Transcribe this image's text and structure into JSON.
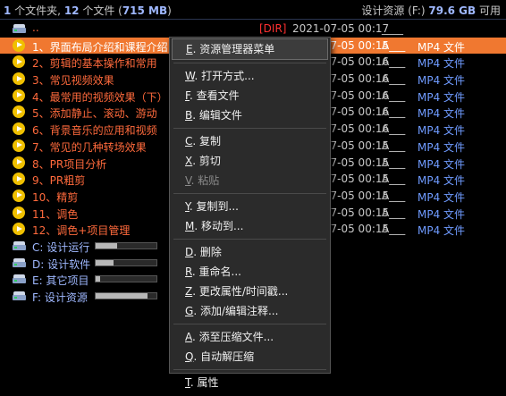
{
  "header": {
    "folders_count": "1",
    "folders_text": " 个文件夹, ",
    "files_count": "12",
    "files_text": " 个文件 (",
    "size": "715 MB",
    "size_close": ")",
    "drive_label": "设计资源 (F:) ",
    "free_space": "79.6 GB",
    "free_text": " 可用"
  },
  "parent_row": {
    "name": "..",
    "tag": "[DIR]",
    "date": "2021-07-05  00:17",
    "attr": "____"
  },
  "files": [
    {
      "name": "1、界面布局介绍和课程介绍",
      "date": "2021-07-05  00:15",
      "attr": "A___",
      "type": "MP4 文件"
    },
    {
      "name": "2、剪辑的基本操作和常用",
      "date": "2021-07-05  00:16",
      "attr": "A___",
      "type": "MP4 文件"
    },
    {
      "name": "3、常见视频效果",
      "date": "2021-07-05  00:16",
      "attr": "A___",
      "type": "MP4 文件"
    },
    {
      "name": "4、最常用的视频效果（下）",
      "date": "2021-07-05  00:16",
      "attr": "A___",
      "type": "MP4 文件"
    },
    {
      "name": "5、添加静止、滚动、游动",
      "date": "2021-07-05  00:16",
      "attr": "A___",
      "type": "MP4 文件"
    },
    {
      "name": "6、背景音乐的应用和视频",
      "date": "2021-07-05  00:16",
      "attr": "A___",
      "type": "MP4 文件"
    },
    {
      "name": "7、常见的几种转场效果",
      "date": "2021-07-05  00:15",
      "attr": "A___",
      "type": "MP4 文件"
    },
    {
      "name": "8、PR项目分析",
      "date": "2021-07-05  00:15",
      "attr": "A___",
      "type": "MP4 文件"
    },
    {
      "name": "9、PR粗剪",
      "date": "2021-07-05  00:15",
      "attr": "A___",
      "type": "MP4 文件"
    },
    {
      "name": "10、精剪",
      "date": "2021-07-05  00:15",
      "attr": "A___",
      "type": "MP4 文件"
    },
    {
      "name": "11、调色",
      "date": "2021-07-05  00:15",
      "attr": "A___",
      "type": "MP4 文件"
    },
    {
      "name": "12、调色+项目管理",
      "date": "2021-07-05  00:15",
      "attr": "A___",
      "type": "MP4 文件"
    }
  ],
  "drives": [
    {
      "name": "C: 设计运行",
      "used_fraction": 0.35
    },
    {
      "name": "D: 设计软件",
      "used_fraction": 0.3
    },
    {
      "name": "E: 其它项目",
      "used_fraction": 0.08
    },
    {
      "name": "F: 设计资源",
      "used_fraction": 0.85
    }
  ],
  "context_menu": {
    "items": [
      {
        "key": "E",
        "label": ". 资源管理器菜单",
        "disabled": false
      },
      {
        "sep": true
      },
      {
        "key": "W",
        "label": ". 打开方式...",
        "disabled": false
      },
      {
        "key": "F",
        "label": ". 查看文件",
        "disabled": false
      },
      {
        "key": "B",
        "label": ". 编辑文件",
        "disabled": false
      },
      {
        "sep": true
      },
      {
        "key": "C",
        "label": ". 复制",
        "disabled": false
      },
      {
        "key": "X",
        "label": ". 剪切",
        "disabled": false
      },
      {
        "key": "V",
        "label": ". 粘贴",
        "disabled": true
      },
      {
        "sep": true
      },
      {
        "key": "Y",
        "label": ". 复制到...",
        "disabled": false
      },
      {
        "key": "M",
        "label": ". 移动到...",
        "disabled": false
      },
      {
        "sep": true
      },
      {
        "key": "D",
        "label": ". 删除",
        "disabled": false
      },
      {
        "key": "R",
        "label": ". 重命名...",
        "disabled": false
      },
      {
        "key": "Z",
        "label": ". 更改属性/时间戳...",
        "disabled": false
      },
      {
        "key": "G",
        "label": ". 添加/编辑注释...",
        "disabled": false
      },
      {
        "sep": true
      },
      {
        "key": "A",
        "label": ". 添至压缩文件...",
        "disabled": false
      },
      {
        "key": "Q",
        "label": ". 自动解压缩",
        "disabled": false
      },
      {
        "sep": true
      },
      {
        "key": "T",
        "label": ". 属性",
        "disabled": false
      }
    ]
  }
}
